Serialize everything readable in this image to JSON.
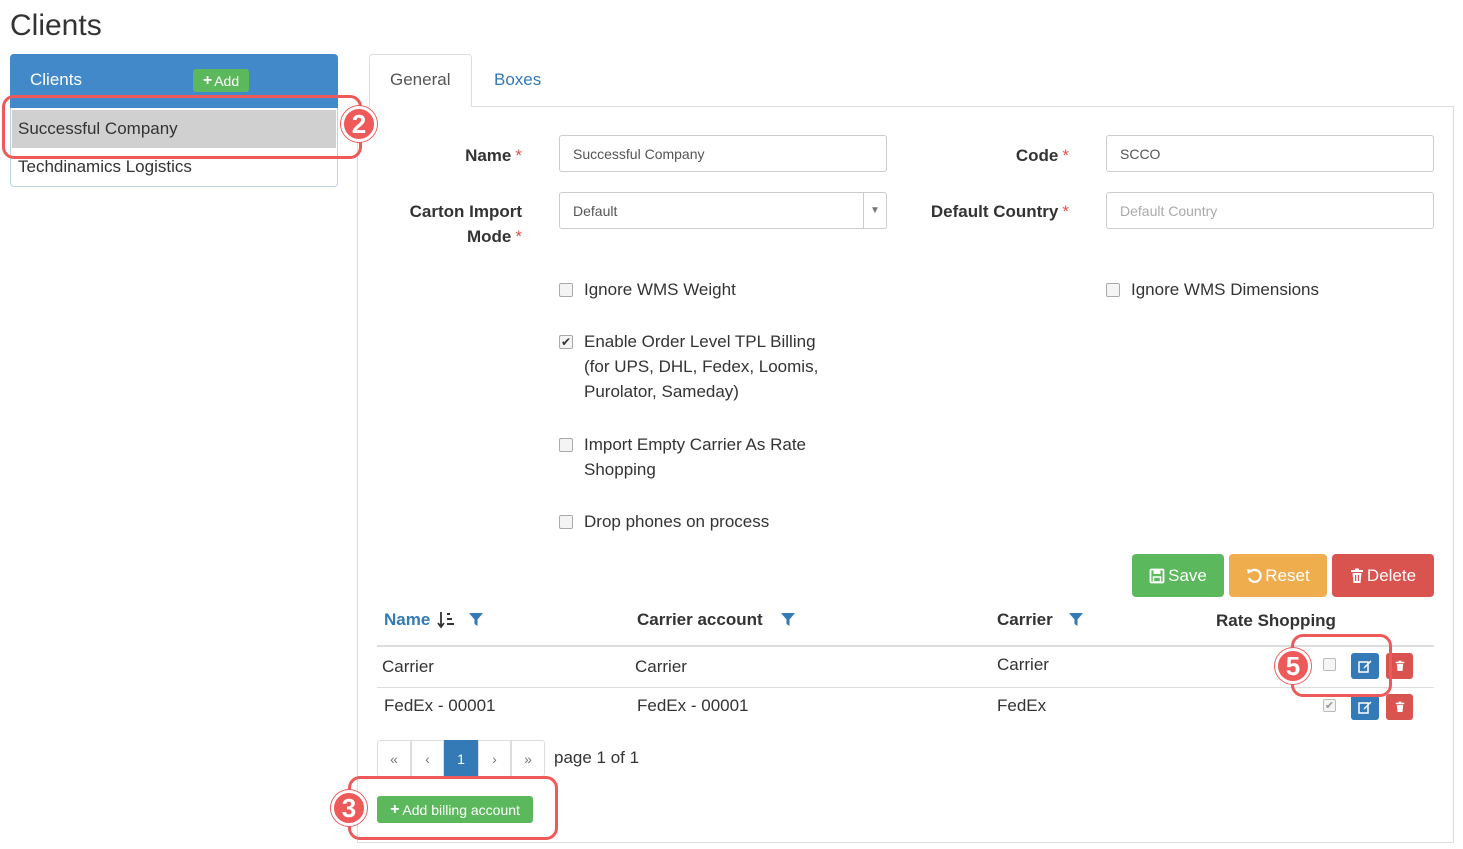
{
  "page": {
    "title": "Clients"
  },
  "client_list": {
    "header": "Clients",
    "add_label": "Add",
    "items": [
      {
        "label": "Successful Company",
        "selected": true
      },
      {
        "label": "Techdinamics Logistics",
        "selected": false
      }
    ]
  },
  "tabs": [
    {
      "label": "General",
      "active": true
    },
    {
      "label": "Boxes",
      "active": false
    }
  ],
  "form": {
    "name_label": "Name",
    "name_value": "Successful Company",
    "code_label": "Code",
    "code_value": "SCCO",
    "carton_label_line1": "Carton Import",
    "carton_label_line2": "Mode",
    "carton_value": "Default",
    "country_label": "Default Country",
    "country_placeholder": "Default Country",
    "required_mark": "*",
    "checkboxes": {
      "ignore_weight": {
        "label": "Ignore WMS Weight",
        "checked": false
      },
      "ignore_dimensions": {
        "label": "Ignore WMS Dimensions",
        "checked": false
      },
      "order_level_billing": {
        "line1": "Enable Order Level TPL Billing",
        "line2": "(for UPS, DHL, Fedex, Loomis,",
        "line3": "Purolator, Sameday)",
        "checked": true
      },
      "empty_carrier": {
        "line1": "Import Empty Carrier As Rate",
        "line2": "Shopping",
        "checked": false
      },
      "drop_phones": {
        "label": "Drop phones on process",
        "checked": false
      }
    }
  },
  "actions": {
    "save": "Save",
    "reset": "Reset",
    "delete": "Delete"
  },
  "billing_table": {
    "columns": [
      "Name",
      "Carrier account",
      "Carrier",
      "Rate Shopping"
    ],
    "rows": [
      {
        "name": "Carrier",
        "account": "Carrier",
        "carrier": "Carrier",
        "rate_shopping": false
      },
      {
        "name": "FedEx - 00001",
        "account": "FedEx - 00001",
        "carrier": "FedEx",
        "rate_shopping": true
      }
    ]
  },
  "pagination": {
    "first": "«",
    "prev": "‹",
    "current": "1",
    "next": "›",
    "last": "»",
    "summary": "page 1 of 1"
  },
  "add_billing_label": "Add billing account",
  "callouts": [
    "2",
    "3",
    "5"
  ],
  "colors": {
    "primary": "#337ab7",
    "success": "#5cb85c",
    "warning": "#f0ad4e",
    "danger": "#d9534f",
    "callout": "#ee5a5a"
  }
}
